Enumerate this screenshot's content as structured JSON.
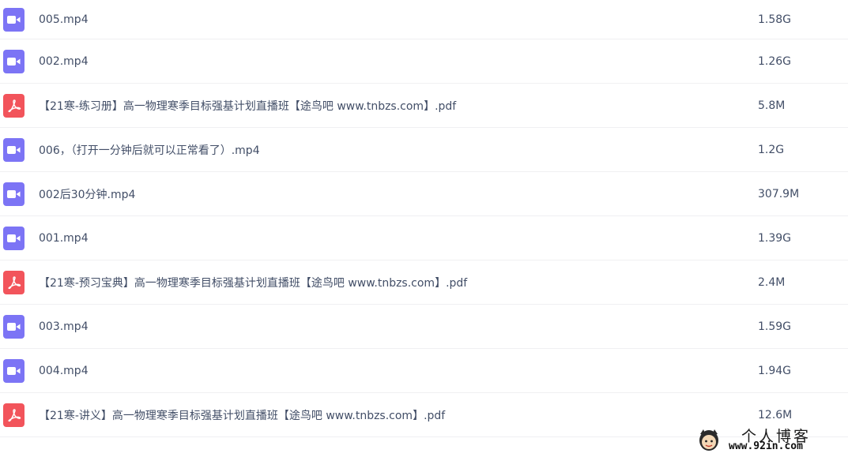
{
  "files": [
    {
      "type": "video",
      "icon": "video-file-icon",
      "name": "005.mp4",
      "size": "1.58G"
    },
    {
      "type": "video",
      "icon": "video-file-icon",
      "name": "002.mp4",
      "size": "1.26G"
    },
    {
      "type": "pdf",
      "icon": "pdf-file-icon",
      "name": "【21寒-练习册】高一物理寒季目标强基计划直播班【途鸟吧 www.tnbzs.com】.pdf",
      "size": "5.8M"
    },
    {
      "type": "video",
      "icon": "video-file-icon",
      "name": "006，（打开一分钟后就可以正常看了）.mp4",
      "size": "1.2G"
    },
    {
      "type": "video",
      "icon": "video-file-icon",
      "name": "002后30分钟.mp4",
      "size": "307.9M"
    },
    {
      "type": "video",
      "icon": "video-file-icon",
      "name": "001.mp4",
      "size": "1.39G"
    },
    {
      "type": "pdf",
      "icon": "pdf-file-icon",
      "name": "【21寒-预习宝典】高一物理寒季目标强基计划直播班【途鸟吧 www.tnbzs.com】.pdf",
      "size": "2.4M"
    },
    {
      "type": "video",
      "icon": "video-file-icon",
      "name": "003.mp4",
      "size": "1.59G"
    },
    {
      "type": "video",
      "icon": "video-file-icon",
      "name": "004.mp4",
      "size": "1.94G"
    },
    {
      "type": "pdf",
      "icon": "pdf-file-icon",
      "name": "【21寒-讲义】高一物理寒季目标强基计划直播班【途鸟吧 www.tnbzs.com】.pdf",
      "size": "12.6M"
    }
  ],
  "watermark": {
    "title": "个人博客",
    "url": "www.92in.com",
    "icon": "mascot-logo-icon"
  },
  "colors": {
    "video_icon": "#7c74f5",
    "pdf_icon": "#f2545b",
    "text": "#424e67",
    "divider": "#f0f0f2"
  }
}
